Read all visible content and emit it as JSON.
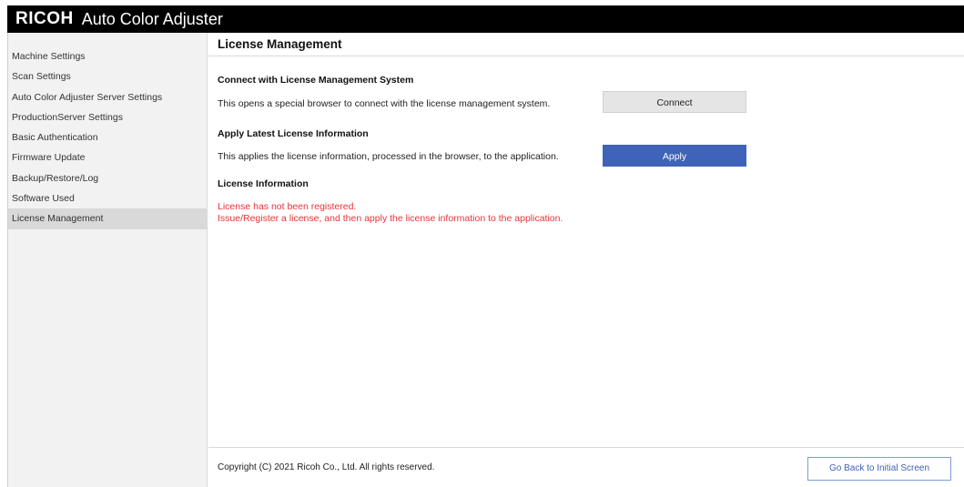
{
  "titlebar": {
    "brand": "RICOH",
    "app_name": "Auto Color Adjuster"
  },
  "sidebar": {
    "items": [
      {
        "label": "Machine Settings",
        "active": false
      },
      {
        "label": "Scan Settings",
        "active": false
      },
      {
        "label": "Auto Color Adjuster Server Settings",
        "active": false
      },
      {
        "label": "ProductionServer Settings",
        "active": false
      },
      {
        "label": "Basic Authentication",
        "active": false
      },
      {
        "label": "Firmware Update",
        "active": false
      },
      {
        "label": "Backup/Restore/Log",
        "active": false
      },
      {
        "label": "Software Used",
        "active": false
      },
      {
        "label": "License Management",
        "active": true
      }
    ]
  },
  "main": {
    "page_title": "License Management",
    "connect_section": {
      "title": "Connect with License Management System",
      "description": "This opens a special browser to connect with the license management system.",
      "button_label": "Connect"
    },
    "apply_section": {
      "title": "Apply Latest License Information",
      "description": "This applies the license information, processed in the browser, to the application.",
      "button_label": "Apply"
    },
    "info_section": {
      "title": "License Information",
      "message_line1": "License has not been registered.",
      "message_line2": "Issue/Register a license, and then apply the license information to the application."
    }
  },
  "footer": {
    "copyright": "Copyright (C) 2021 Ricoh Co., Ltd. All rights reserved.",
    "back_button_label": "Go Back to Initial Screen"
  },
  "colors": {
    "titlebar_bg": "#000000",
    "apply_button_bg": "#3f63b8",
    "error_text": "#e8333a",
    "sidebar_bg": "#f2f2f2",
    "sidebar_active_bg": "#d9d9d9"
  }
}
